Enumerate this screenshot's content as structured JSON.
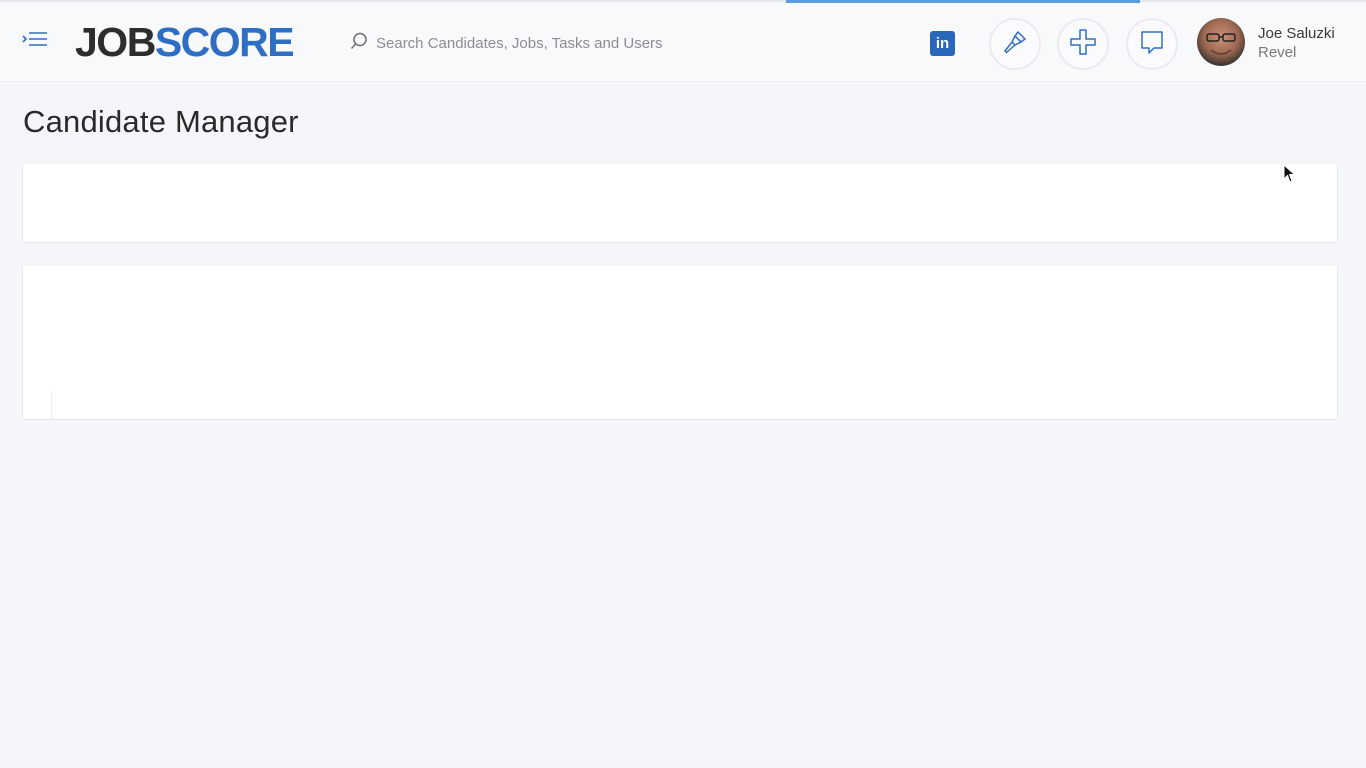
{
  "header": {
    "logo_part1": "JOB",
    "logo_part2": "SCORE",
    "search_placeholder": "Search Candidates, Jobs, Tasks and Users",
    "linkedin_label": "in",
    "user": {
      "name": "Joe Saluzki",
      "org": "Revel"
    }
  },
  "page": {
    "title": "Candidate Manager"
  },
  "colors": {
    "brand_blue": "#2e6fc4",
    "linkedin_blue": "#2a66bc",
    "progress": "#5b9be0"
  },
  "icons": [
    "menu-icon",
    "search-icon",
    "linkedin-icon",
    "brush-icon",
    "plus-icon",
    "chat-icon"
  ]
}
